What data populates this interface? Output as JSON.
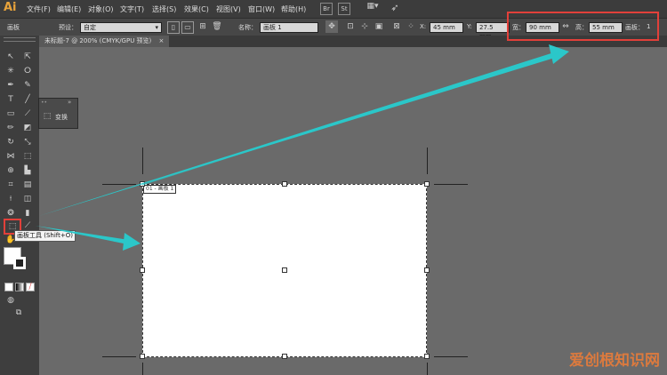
{
  "app": {
    "logo": "Ai"
  },
  "menu": [
    "文件(F)",
    "编辑(E)",
    "对象(O)",
    "文字(T)",
    "选择(S)",
    "效果(C)",
    "视图(V)",
    "窗口(W)",
    "帮助(H)"
  ],
  "controlbar": {
    "panel_label": "画板",
    "preset_label": "预设：",
    "preset_value": "自定",
    "name_label": "名称：",
    "name_value": "画板 1",
    "x_label": "X:",
    "x_value": "45 mm",
    "y_label": "Y:",
    "y_value": "27.5 mm",
    "width_label": "宽：",
    "width_value": "90 mm",
    "height_label": "高：",
    "height_value": "55 mm",
    "artboards_label": "画板：",
    "artboards_value": "1"
  },
  "document_tab": {
    "title": "未标题-7 @ 200% (CMYK/GPU 预览)",
    "close": "×"
  },
  "flyout": {
    "label": "变换"
  },
  "tooltip": {
    "text": "画板工具 (Shift+O)"
  },
  "artboard": {
    "label": "01 - 画板 1"
  },
  "watermark": {
    "text": "爱创根知识网"
  },
  "colors": {
    "annotation_red": "#e2403a",
    "arrow_teal": "#2bc7c9",
    "logo_orange": "#e8a33b"
  }
}
